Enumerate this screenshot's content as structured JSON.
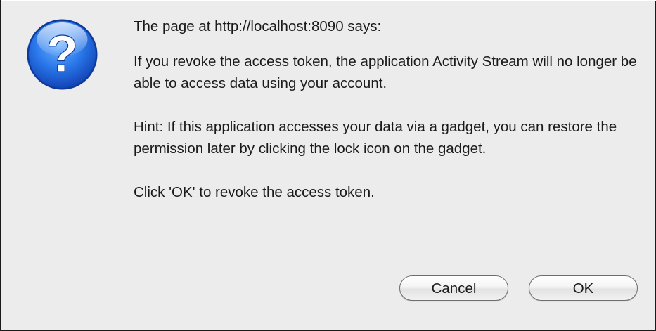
{
  "dialog": {
    "title": "The page at http://localhost:8090 says:",
    "message": "If you revoke the access token, the application Activity Stream will no longer be able to access data using your account.",
    "hint": "Hint: If this application accesses your data via a gadget, you can restore the permission later by clicking the lock icon on the gadget.",
    "instruction": "Click 'OK' to revoke the access token.",
    "icon": "question-mark-icon"
  },
  "buttons": {
    "cancel_label": "Cancel",
    "ok_label": "OK"
  },
  "colors": {
    "dialog_background": "#ececec",
    "icon_blue": "#1e66d8",
    "text": "#1a1a1a"
  }
}
